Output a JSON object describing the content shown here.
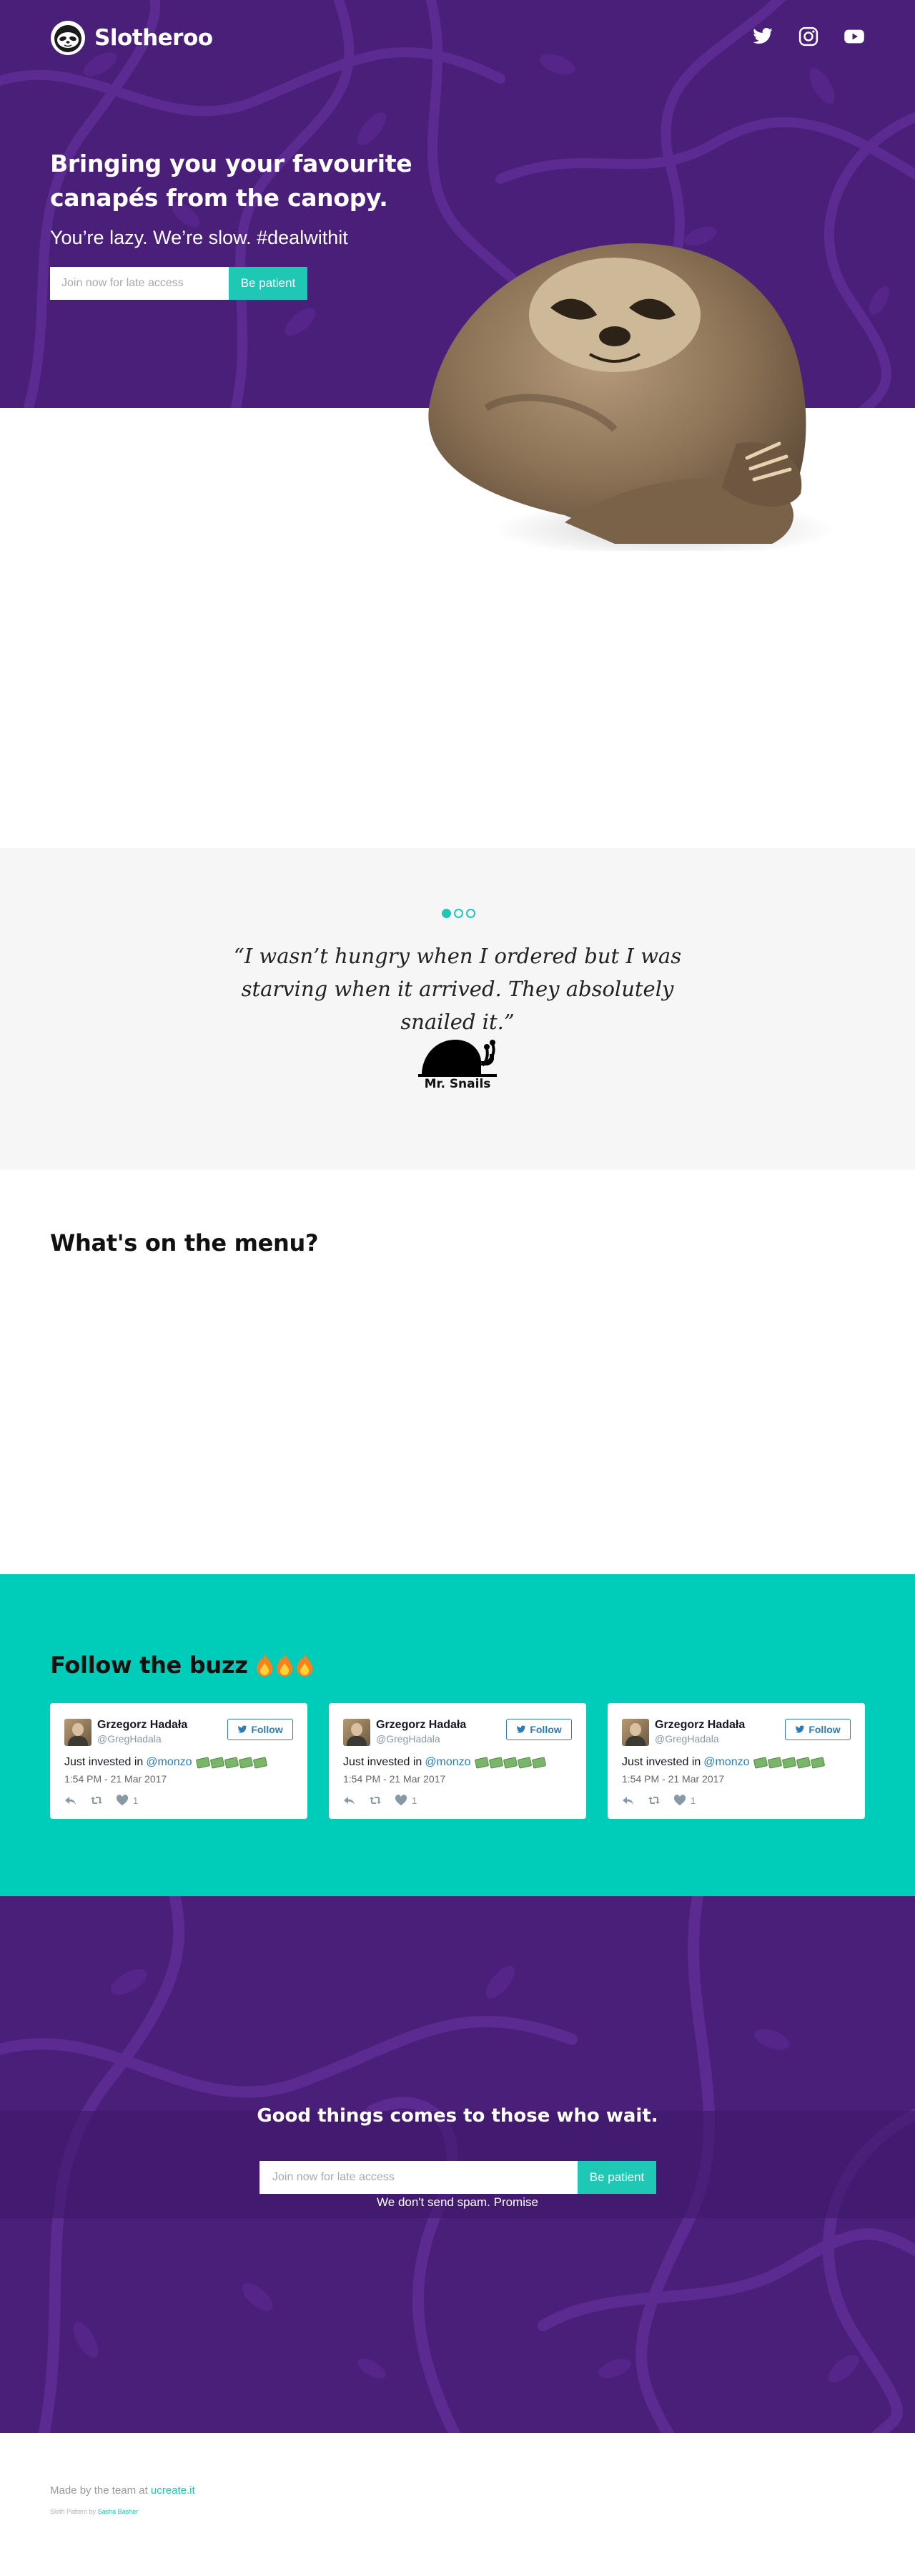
{
  "brand": {
    "name": "Slotheroo"
  },
  "nav": {
    "social": [
      "twitter-icon",
      "instagram-icon",
      "youtube-icon"
    ]
  },
  "hero": {
    "title_line1": "Bringing you your favourite",
    "title_line2": "canapés from the canopy.",
    "subtitle": "You’re lazy. We’re slow. #dealwithit",
    "input_placeholder": "Join now for late access",
    "button_label": "Be patient"
  },
  "testimonial": {
    "quote": "“I wasn’t hungry when I ordered but I was starving when it arrived. They absolutely snailed it.”",
    "author": "Mr. Snails",
    "active_slide": 1,
    "slide_count": 3
  },
  "menu": {
    "title": "What's on the menu?"
  },
  "buzz": {
    "title": "Follow the buzz",
    "tweets": [
      {
        "name": "Grzegorz Hadała",
        "handle": "@GregHadala",
        "follow": "Follow",
        "text": "Just invested in",
        "mention": "@monzo",
        "time": "1:54 PM - 21 Mar 2017",
        "likes": "1"
      },
      {
        "name": "Grzegorz Hadała",
        "handle": "@GregHadala",
        "follow": "Follow",
        "text": "Just invested in",
        "mention": "@monzo",
        "time": "1:54 PM - 21 Mar 2017",
        "likes": "1"
      },
      {
        "name": "Grzegorz Hadała",
        "handle": "@GregHadala",
        "follow": "Follow",
        "text": "Just invested in",
        "mention": "@monzo",
        "time": "1:54 PM - 21 Mar 2017",
        "likes": "1"
      }
    ]
  },
  "cta": {
    "title": "Good things comes to those who wait.",
    "input_placeholder": "Join now for late access",
    "button_label": "Be patient",
    "note": "We don't send spam. Promise"
  },
  "footer": {
    "made_by": "Made by the team at",
    "made_link": "ucreate.it",
    "credit": "Sloth Pattern by",
    "credit_link": "Sasha Basher"
  },
  "colors": {
    "purple": "#4a1f7a",
    "teal": "#1ec8b4",
    "buzz_bg": "#00cdb9",
    "testimonial_bg": "#f6f6f6"
  }
}
